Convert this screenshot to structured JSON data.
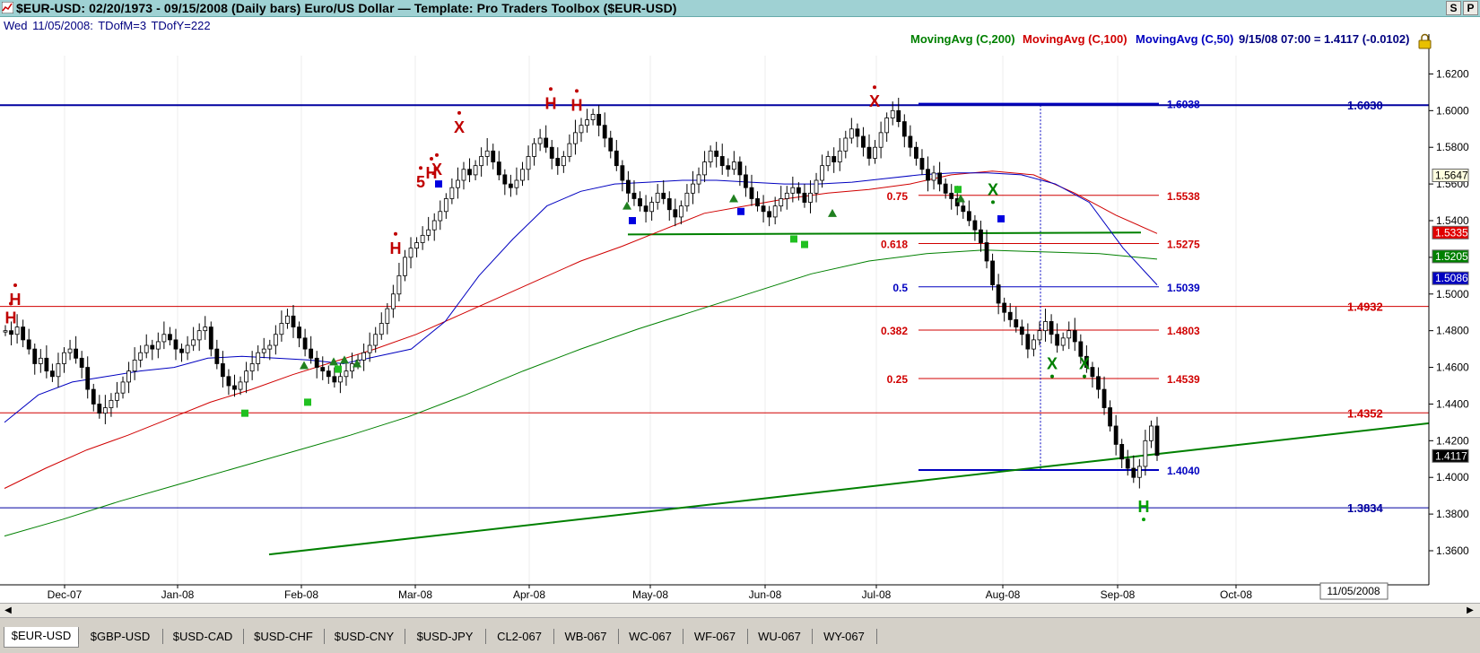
{
  "window": {
    "title": "$EUR-USD:  02/20/1973 - 09/15/2008  (Daily bars)   Euro/US Dollar  —  Template: Pro Traders Toolbox ($EUR-USD)",
    "btn_s": "S",
    "btn_p": "P"
  },
  "infoline": {
    "day": "Wed",
    "date": "11/05/2008:",
    "tdofm": "TDofM=3",
    "tdofy": "TDofY=222"
  },
  "legend": {
    "ma200": "MovingAvg (C,200)",
    "ma100": "MovingAvg (C,100)",
    "ma50": "MovingAvg (C,50)",
    "quote": "9/15/08 07:00 = 1.4117 (-0.0102)"
  },
  "colors": {
    "ma200": "#008000",
    "ma100": "#d00000",
    "ma50": "#0000c0",
    "bull": "#ffffff",
    "bear": "#000000",
    "accent": "#9fd1d3"
  },
  "chart_data": {
    "type": "candlestick",
    "ylim": [
      1.36,
      1.63
    ],
    "x_tick_labels": [
      "Dec-07",
      "Jan-08",
      "Feb-08",
      "Mar-08",
      "Apr-08",
      "May-08",
      "Jun-08",
      "Jul-08",
      "Aug-08",
      "Sep-08",
      "Oct-08"
    ],
    "y_tick_labels": [
      "1.6200",
      "1.6000",
      "1.5800",
      "1.5600",
      "1.5400",
      "1.5200",
      "1.5000",
      "1.4800",
      "1.4600",
      "1.4400",
      "1.4200",
      "1.4000",
      "1.3800",
      "1.3600"
    ],
    "price_tags": [
      {
        "value": 1.5647,
        "label": "1.5647",
        "bg": "#ffffe0",
        "fg": "#000000"
      },
      {
        "value": 1.5335,
        "label": "1.5335",
        "bg": "#e00000",
        "fg": "#ffffff"
      },
      {
        "value": 1.5205,
        "label": "1.5205",
        "bg": "#008000",
        "fg": "#ffffff"
      },
      {
        "value": 1.5086,
        "label": "1.5086",
        "bg": "#0000c0",
        "fg": "#ffffff"
      },
      {
        "value": 1.4117,
        "label": "1.4117",
        "bg": "#000000",
        "fg": "#ffffff"
      }
    ],
    "levels": [
      {
        "value": 1.603,
        "label": "1.6030",
        "color": "#0000a0"
      },
      {
        "value": 1.4932,
        "label": "1.4932",
        "color": "#d00000"
      },
      {
        "value": 1.4352,
        "label": "1.4352",
        "color": "#d00000"
      },
      {
        "value": 1.3834,
        "label": "1.3834",
        "color": "#0000a0"
      }
    ],
    "fib_levels": [
      {
        "ratio": "",
        "value": 1.6038,
        "label": "1.6038",
        "color": "#0000c0"
      },
      {
        "ratio": "0.75",
        "value": 1.5538,
        "label": "1.5538",
        "color": "#d00000"
      },
      {
        "ratio": "0.618",
        "value": 1.5275,
        "label": "1.5275",
        "color": "#d00000"
      },
      {
        "ratio": "0.5",
        "value": 1.5039,
        "label": "1.5039",
        "color": "#0000c0"
      },
      {
        "ratio": "0.382",
        "value": 1.4803,
        "label": "1.4803",
        "color": "#d00000"
      },
      {
        "ratio": "0.25",
        "value": 1.4539,
        "label": "1.4539",
        "color": "#d00000"
      },
      {
        "ratio": "",
        "value": 1.404,
        "label": "1.4040",
        "color": "#0000c0"
      }
    ],
    "ma50": [
      1.43,
      1.445,
      1.452,
      1.455,
      1.458,
      1.46,
      1.465,
      1.466,
      1.465,
      1.464,
      1.462,
      1.466,
      1.47,
      1.485,
      1.51,
      1.53,
      1.548,
      1.556,
      1.56,
      1.561,
      1.562,
      1.562,
      1.561,
      1.56,
      1.56,
      1.561,
      1.563,
      1.565,
      1.566,
      1.566,
      1.565,
      1.56,
      1.55,
      1.525,
      1.505
    ],
    "ma100": [
      1.394,
      1.405,
      1.415,
      1.423,
      1.432,
      1.441,
      1.448,
      1.456,
      1.463,
      1.47,
      1.478,
      1.488,
      1.498,
      1.508,
      1.518,
      1.526,
      1.535,
      1.544,
      1.548,
      1.552,
      1.555,
      1.557,
      1.56,
      1.565,
      1.567,
      1.565,
      1.555,
      1.543,
      1.533
    ],
    "ma200": [
      1.368,
      1.377,
      1.387,
      1.396,
      1.405,
      1.414,
      1.423,
      1.433,
      1.445,
      1.458,
      1.47,
      1.481,
      1.491,
      1.501,
      1.511,
      1.518,
      1.522,
      1.524,
      1.523,
      1.522,
      1.519
    ],
    "closes": [
      1.48,
      1.478,
      1.482,
      1.475,
      1.47,
      1.462,
      1.465,
      1.458,
      1.455,
      1.462,
      1.468,
      1.47,
      1.465,
      1.46,
      1.448,
      1.44,
      1.435,
      1.438,
      1.442,
      1.446,
      1.452,
      1.458,
      1.464,
      1.468,
      1.472,
      1.47,
      1.474,
      1.478,
      1.475,
      1.47,
      1.468,
      1.472,
      1.475,
      1.48,
      1.482,
      1.47,
      1.462,
      1.455,
      1.45,
      1.448,
      1.452,
      1.458,
      1.462,
      1.468,
      1.47,
      1.472,
      1.478,
      1.484,
      1.488,
      1.482,
      1.476,
      1.47,
      1.465,
      1.46,
      1.458,
      1.455,
      1.452,
      1.455,
      1.458,
      1.462,
      1.464,
      1.468,
      1.472,
      1.478,
      1.484,
      1.492,
      1.5,
      1.51,
      1.52,
      1.525,
      1.528,
      1.532,
      1.535,
      1.54,
      1.545,
      1.552,
      1.558,
      1.562,
      1.568,
      1.565,
      1.57,
      1.575,
      1.578,
      1.572,
      1.565,
      1.56,
      1.558,
      1.562,
      1.568,
      1.575,
      1.582,
      1.585,
      1.58,
      1.574,
      1.57,
      1.575,
      1.582,
      1.588,
      1.592,
      1.595,
      1.598,
      1.592,
      1.585,
      1.578,
      1.57,
      1.562,
      1.555,
      1.552,
      1.548,
      1.545,
      1.55,
      1.555,
      1.552,
      1.546,
      1.542,
      1.548,
      1.555,
      1.56,
      1.565,
      1.572,
      1.578,
      1.575,
      1.57,
      1.568,
      1.572,
      1.565,
      1.558,
      1.552,
      1.548,
      1.545,
      1.542,
      1.548,
      1.552,
      1.555,
      1.558,
      1.555,
      1.55,
      1.555,
      1.562,
      1.57,
      1.575,
      1.572,
      1.578,
      1.585,
      1.59,
      1.586,
      1.58,
      1.574,
      1.58,
      1.588,
      1.596,
      1.6,
      1.594,
      1.586,
      1.58,
      1.574,
      1.568,
      1.562,
      1.566,
      1.56,
      1.555,
      1.552,
      1.548,
      1.545,
      1.54,
      1.535,
      1.528,
      1.518,
      1.505,
      1.495,
      1.49,
      1.486,
      1.482,
      1.478,
      1.47,
      1.475,
      1.48,
      1.485,
      1.478,
      1.472,
      1.476,
      1.48,
      1.474,
      1.466,
      1.46,
      1.455,
      1.448,
      1.438,
      1.428,
      1.418,
      1.41,
      1.405,
      1.4,
      1.406,
      1.42,
      1.428,
      1.412
    ]
  },
  "markers": [
    {
      "text": "H",
      "color": "#c00000"
    },
    {
      "text": "H",
      "color": "#c00000"
    },
    {
      "text": "H",
      "color": "#c00000"
    },
    {
      "text": "5",
      "color": "#c00000"
    },
    {
      "text": "H",
      "color": "#c00000"
    },
    {
      "text": "X",
      "color": "#c00000"
    },
    {
      "text": "X",
      "color": "#c00000"
    },
    {
      "text": "H",
      "color": "#c00000"
    },
    {
      "text": "H",
      "color": "#c00000"
    },
    {
      "text": "X",
      "color": "#c00000"
    },
    {
      "text": "X",
      "color": "#008000"
    },
    {
      "text": "X",
      "color": "#008000"
    },
    {
      "text": "X",
      "color": "#008000"
    },
    {
      "text": "H",
      "color": "#00a000"
    }
  ],
  "date_box": "11/05/2008",
  "tabs": [
    "$EUR-USD",
    "$GBP-USD",
    "$USD-CAD",
    "$USD-CHF",
    "$USD-CNY",
    "$USD-JPY",
    "CL2-067",
    "WB-067",
    "WC-067",
    "WF-067",
    "WU-067",
    "WY-067"
  ]
}
